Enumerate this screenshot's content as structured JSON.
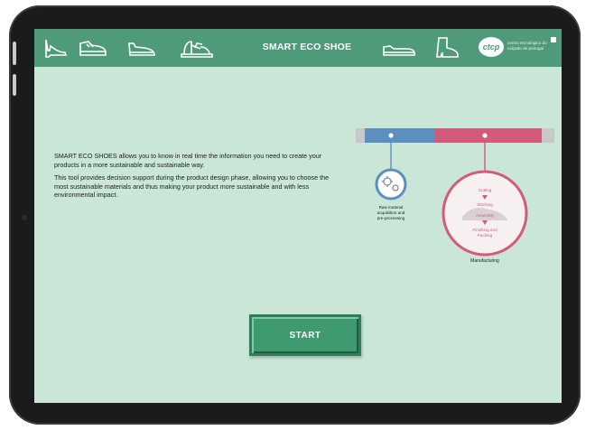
{
  "header": {
    "title": "SMART ECO SHOE",
    "logo_mark": "ctcp",
    "logo_text": "centro tecnológico do calçado de portugal",
    "icons": [
      "heel-shoe-icon",
      "sneaker-icon",
      "loafer-icon",
      "sandal-icon",
      "flat-shoe-icon",
      "boot-icon"
    ]
  },
  "intro": {
    "paragraph1": "SMART ECO SHOES allows you to know in real time the information you need to create your products in a more sustainable and sustainable way.",
    "paragraph2": "This tool provides decision support during the product design phase, allowing you to choose the most sustainable materials and thus making your product more sustainable and with less environmental impact."
  },
  "diagram": {
    "stage1_label": "Raw material acquisition and pre-processing",
    "stage2_label": "Manufacturing",
    "stage2_steps": [
      "Cutting",
      "Stitching",
      "Assembly",
      "Finishing and Packing"
    ],
    "colors": {
      "blue": "#5b8fbf",
      "pink": "#d25a7a",
      "grey": "#c8c8c8"
    }
  },
  "start_button": {
    "label": "START"
  },
  "colors": {
    "header": "#4f9a78",
    "background": "#c9e6d6",
    "button": "#3f9a70"
  }
}
